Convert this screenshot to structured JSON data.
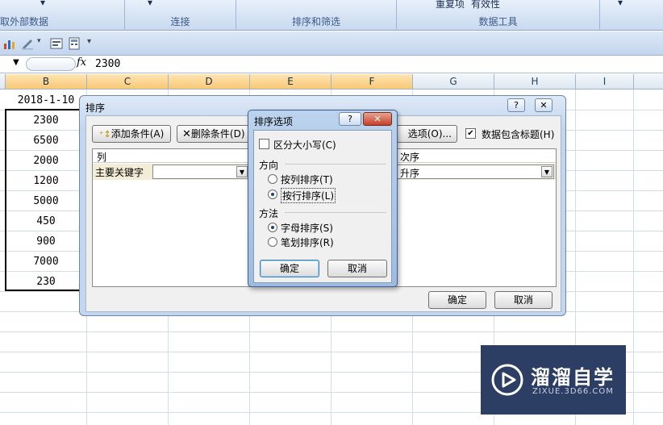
{
  "ribbon": {
    "groups": [
      "获取外部数据",
      "连接",
      "排序和筛选",
      "数据工具"
    ],
    "partial_buttons": [
      "重复项",
      "有效性"
    ]
  },
  "formula_bar": {
    "fx": "fx",
    "value": "2300"
  },
  "columns": [
    "B",
    "C",
    "D",
    "E",
    "F",
    "G",
    "H",
    "I"
  ],
  "cells": {
    "B_header_value": "2018-1-10",
    "values": [
      "2300",
      "6500",
      "2000",
      "1200",
      "5000",
      "450",
      "900",
      "7000",
      "230"
    ]
  },
  "sort_dialog": {
    "title": "排序",
    "title_buttons": [
      "?",
      "✕"
    ],
    "add_condition": "添加条件(A)",
    "delete_condition": "删除条件(D)",
    "options": "选项(O)...",
    "has_header_label": "数据包含标题(H)",
    "has_header_checked": true,
    "col_header": "列",
    "order_header": "次序",
    "primary_key_label": "主要关键字",
    "order_value": "升序",
    "ok": "确定",
    "cancel": "取消"
  },
  "options_dialog": {
    "title": "排序选项",
    "title_buttons": [
      "?",
      "✕"
    ],
    "case_sensitive": "区分大小写(C)",
    "direction_label": "方向",
    "by_column": "按列排序(T)",
    "by_row": "按行排序(L)",
    "method_label": "方法",
    "alphabetic": "字母排序(S)",
    "stroke": "笔划排序(R)",
    "ok": "确定",
    "cancel": "取消"
  },
  "watermark": {
    "title": "溜溜自学",
    "url": "ZIXUE.3D66.COM"
  },
  "colors": {
    "selected_header": "#f8c876",
    "watermark_bg": "#2c3e63"
  }
}
